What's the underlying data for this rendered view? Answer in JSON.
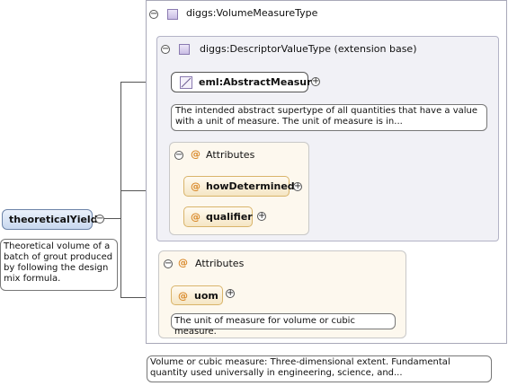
{
  "volume_type": {
    "title": "diggs:VolumeMeasureType",
    "doc": "Volume or cubic measure: Three-dimensional extent. Fundamental quantity used universally in engineering, science, and..."
  },
  "descriptor_type": {
    "title": "diggs:DescriptorValueType (extension base)"
  },
  "abstract_measure": {
    "label": "eml:AbstractMeasure",
    "doc": "The intended abstract supertype of all quantities that have a value with a unit of measure. The unit of measure is in..."
  },
  "inner_attributes": {
    "title": "Attributes",
    "items": [
      "howDetermined",
      "qualifier"
    ]
  },
  "outer_attributes": {
    "title": "Attributes",
    "uom_label": "uom",
    "uom_doc": "The unit of measure for volume or cubic measure."
  },
  "root_element": {
    "label": "theoreticalYield",
    "doc": "Theoretical volume of a batch of grout produced by following the design mix formula."
  },
  "symbols": {
    "attribute": "@",
    "expand": "+",
    "collapse": "−"
  }
}
